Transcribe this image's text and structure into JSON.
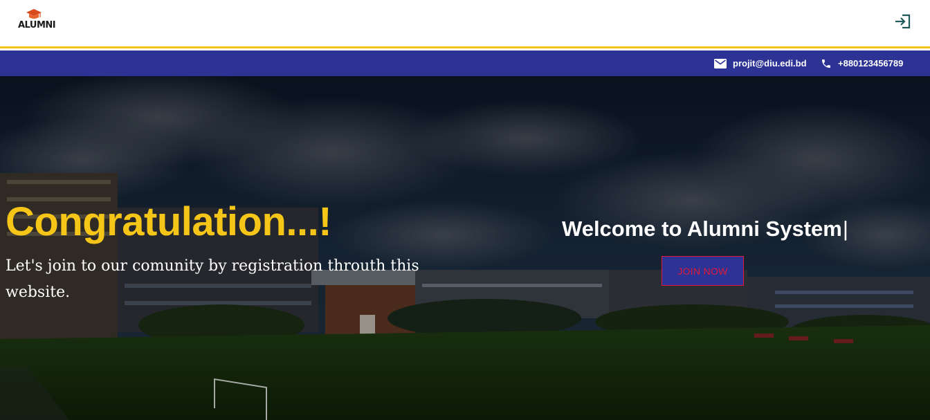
{
  "navbar": {
    "logo_text": "ALUMNI",
    "logo_icon": "graduation-cap-icon",
    "login_icon": "login-icon"
  },
  "topbar": {
    "email_icon": "mail-icon",
    "email": "projit@diu.edi.bd",
    "phone_icon": "phone-icon",
    "phone": "+880123456789"
  },
  "hero": {
    "title": "Congratulation...!",
    "subtitle": "Let's join to our comunity by registration throuth this website.",
    "welcome": "Welcome to Alumni System",
    "cursor": "|",
    "join_label": "JOIN NOW"
  },
  "colors": {
    "accent_yellow": "#f5c518",
    "topbar_blue": "#2c3394",
    "button_border_red": "#e3183a"
  }
}
